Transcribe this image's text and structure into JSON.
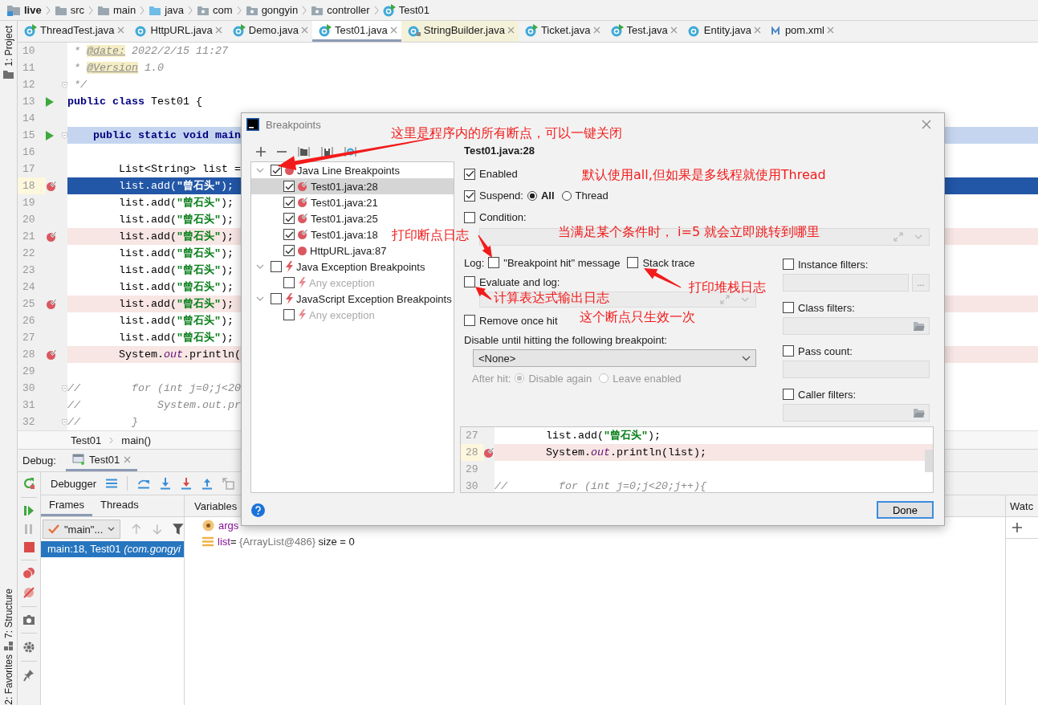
{
  "breadcrumb": [
    {
      "label": "live",
      "kind": "module"
    },
    {
      "label": "src",
      "kind": "folder"
    },
    {
      "label": "main",
      "kind": "folder"
    },
    {
      "label": "java",
      "kind": "source-root"
    },
    {
      "label": "com",
      "kind": "package"
    },
    {
      "label": "gongyin",
      "kind": "package"
    },
    {
      "label": "controller",
      "kind": "package"
    },
    {
      "label": "Test01",
      "kind": "class"
    }
  ],
  "tool_windows": {
    "top": [
      {
        "label": "1: Project",
        "kind": "project"
      }
    ],
    "bottom": [
      {
        "label": "7: Structure",
        "kind": "structure"
      },
      {
        "label": "2: Favorites",
        "kind": "favorites"
      }
    ]
  },
  "tabs": [
    {
      "label": "ThreadTest.java",
      "kind": "runnable",
      "selected": false
    },
    {
      "label": "HttpURL.java",
      "kind": "class",
      "selected": false
    },
    {
      "label": "Demo.java",
      "kind": "runnable",
      "selected": false
    },
    {
      "label": "Test01.java",
      "kind": "runnable",
      "selected": true
    },
    {
      "label": "StringBuilder.java",
      "kind": "library",
      "selected": false
    },
    {
      "label": "Ticket.java",
      "kind": "runnable",
      "selected": false
    },
    {
      "label": "Test.java",
      "kind": "runnable",
      "selected": false
    },
    {
      "label": "Entity.java",
      "kind": "class",
      "selected": false
    },
    {
      "label": "pom.xml",
      "kind": "maven",
      "selected": false
    }
  ],
  "editor": {
    "lines": [
      {
        "number": "10",
        "tokens": [
          {
            "text": " * ",
            "kind": "comment"
          },
          {
            "text": "@date:",
            "kind": "doctag"
          },
          {
            "text": " 2022/2/15 11:27",
            "kind": "comment"
          }
        ]
      },
      {
        "number": "11",
        "tokens": [
          {
            "text": " * ",
            "kind": "comment"
          },
          {
            "text": "@Version",
            "kind": "doctag"
          },
          {
            "text": " 1.0",
            "kind": "comment"
          }
        ]
      },
      {
        "number": "12",
        "fold": true,
        "tokens": [
          {
            "text": " */",
            "kind": "comment"
          }
        ]
      },
      {
        "number": "13",
        "run_marker": true,
        "tokens": [
          {
            "text": "public class",
            "kind": "keyword"
          },
          {
            "text": " Test01 {",
            "kind": "plain"
          }
        ]
      },
      {
        "number": "14"
      },
      {
        "number": "15",
        "run_marker": true,
        "fold": true,
        "highlighted": true,
        "tokens": [
          {
            "text": "    public static void main",
            "kind": "keyword"
          }
        ]
      },
      {
        "number": "16"
      },
      {
        "number": "17",
        "tokens": [
          {
            "text": "        List<String> list =",
            "kind": "plain"
          }
        ]
      },
      {
        "number": "18",
        "breakpoint": true,
        "current": true,
        "execution_point": true,
        "tokens": [
          {
            "text": "        list.add(",
            "kind": "plain"
          },
          {
            "text": "\"曾石头\"",
            "kind": "string"
          },
          {
            "text": ");",
            "kind": "plain"
          }
        ]
      },
      {
        "number": "19",
        "tokens": [
          {
            "text": "        list.add(",
            "kind": "plain"
          },
          {
            "text": "\"曾石头\"",
            "kind": "string"
          },
          {
            "text": ");",
            "kind": "plain"
          }
        ]
      },
      {
        "number": "20",
        "tokens": [
          {
            "text": "        list.add(",
            "kind": "plain"
          },
          {
            "text": "\"曾石头\"",
            "kind": "string"
          },
          {
            "text": ");",
            "kind": "plain"
          }
        ]
      },
      {
        "number": "21",
        "breakpoint": true,
        "tokens": [
          {
            "text": "        list.add(",
            "kind": "plain"
          },
          {
            "text": "\"曾石头\"",
            "kind": "string"
          },
          {
            "text": ");",
            "kind": "plain"
          }
        ]
      },
      {
        "number": "22",
        "tokens": [
          {
            "text": "        list.add(",
            "kind": "plain"
          },
          {
            "text": "\"曾石头\"",
            "kind": "string"
          },
          {
            "text": ");",
            "kind": "plain"
          }
        ]
      },
      {
        "number": "23",
        "tokens": [
          {
            "text": "        list.add(",
            "kind": "plain"
          },
          {
            "text": "\"曾石头\"",
            "kind": "string"
          },
          {
            "text": ");",
            "kind": "plain"
          }
        ]
      },
      {
        "number": "24",
        "tokens": [
          {
            "text": "        list.add(",
            "kind": "plain"
          },
          {
            "text": "\"曾石头\"",
            "kind": "string"
          },
          {
            "text": ");",
            "kind": "plain"
          }
        ]
      },
      {
        "number": "25",
        "breakpoint": true,
        "tokens": [
          {
            "text": "        list.add(",
            "kind": "plain"
          },
          {
            "text": "\"曾石头\"",
            "kind": "string"
          },
          {
            "text": ");",
            "kind": "plain"
          }
        ]
      },
      {
        "number": "26",
        "tokens": [
          {
            "text": "        list.add(",
            "kind": "plain"
          },
          {
            "text": "\"曾石头\"",
            "kind": "string"
          },
          {
            "text": ");",
            "kind": "plain"
          }
        ]
      },
      {
        "number": "27",
        "tokens": [
          {
            "text": "        list.add(",
            "kind": "plain"
          },
          {
            "text": "\"曾石头\"",
            "kind": "string"
          },
          {
            "text": ");",
            "kind": "plain"
          }
        ]
      },
      {
        "number": "28",
        "breakpoint": true,
        "tokens": [
          {
            "text": "        System.",
            "kind": "plain"
          },
          {
            "text": "out",
            "kind": "field"
          },
          {
            "text": ".println(",
            "kind": "plain"
          }
        ]
      },
      {
        "number": "29"
      },
      {
        "number": "30",
        "fold": true,
        "tokens": [
          {
            "text": "//        for (int j=0;j<20",
            "kind": "comment"
          }
        ]
      },
      {
        "number": "31",
        "tokens": [
          {
            "text": "//            System.out.pr",
            "kind": "comment"
          }
        ]
      },
      {
        "number": "32",
        "fold": true,
        "tokens": [
          {
            "text": "//        }",
            "kind": "comment"
          }
        ]
      }
    ],
    "crumbs": [
      "Test01",
      "main()"
    ]
  },
  "debug": {
    "label": "Debug:",
    "tab": "Test01",
    "toolbar_title": "Debugger",
    "frame_tabs": [
      {
        "label": "Frames",
        "selected": true
      },
      {
        "label": "Threads",
        "selected": false
      }
    ],
    "thread": "\"main\"...",
    "frames": [
      {
        "text": "main:18, Test01 *(com.gongyi*",
        "selected": true
      }
    ],
    "variables_title": "Variables",
    "variables": [
      {
        "name": "args",
        "kind": "param"
      },
      {
        "name": "list",
        "kind": "field",
        "separator": "=",
        "value": "{ArrayList@486}",
        "extra": "size = 0"
      }
    ],
    "watches_title": "Watc"
  },
  "dialog": {
    "title": "Breakpoints",
    "tree": [
      {
        "label": "Java Line Breakpoints",
        "kind": "line",
        "checked": true,
        "expanded": true,
        "children": [
          {
            "label": "Test01.java:28",
            "kind": "verified",
            "checked": true,
            "selected": true
          },
          {
            "label": "Test01.java:21",
            "kind": "verified",
            "checked": true,
            "selected": false
          },
          {
            "label": "Test01.java:25",
            "kind": "verified",
            "checked": true,
            "selected": false
          },
          {
            "label": "Test01.java:18",
            "kind": "verified",
            "checked": true,
            "selected": false
          },
          {
            "label": "HttpURL.java:87",
            "kind": "line",
            "checked": true,
            "selected": false
          }
        ]
      },
      {
        "label": "Java Exception Breakpoints",
        "kind": "exception",
        "checked": false,
        "expanded": true,
        "children": [
          {
            "label": "Any exception",
            "kind": "exception",
            "checked": false,
            "disabled": true,
            "selected": false
          }
        ]
      },
      {
        "label": "JavaScript Exception Breakpoints",
        "kind": "exception",
        "checked": false,
        "expanded": true,
        "children": [
          {
            "label": "Any exception",
            "kind": "exception",
            "checked": false,
            "disabled": true,
            "selected": false
          }
        ]
      }
    ],
    "detail": {
      "title": "Test01.java:28",
      "enabled": {
        "label": "Enabled",
        "checked": true
      },
      "suspend": {
        "label": "Suspend:",
        "checked": true,
        "options": [
          {
            "label": "All",
            "selected": true
          },
          {
            "label": "Thread",
            "selected": false
          }
        ]
      },
      "condition": {
        "label": "Condition:",
        "checked": false
      },
      "log": {
        "label": "Log:",
        "options": [
          {
            "label": "\"Breakpoint hit\" message",
            "checked": false
          },
          {
            "label": "Stack trace",
            "checked": false
          }
        ]
      },
      "evaluate": {
        "label": "Evaluate and log:",
        "checked": false
      },
      "remove_once_hit": {
        "label": "Remove once hit",
        "checked": false
      },
      "disable_until": {
        "label": "Disable until hitting the following breakpoint:",
        "value": "<None>"
      },
      "after_hit": {
        "label": "After hit:",
        "disabled": true,
        "options": [
          {
            "label": "Disable again",
            "selected": true
          },
          {
            "label": "Leave enabled",
            "selected": false
          }
        ]
      },
      "filters": [
        {
          "label": "Instance filters:",
          "checked": false,
          "kind": "button",
          "button": "..."
        },
        {
          "label": "Class filters:",
          "checked": false,
          "kind": "browse"
        },
        {
          "label": "Pass count:",
          "checked": false,
          "kind": "plain"
        },
        {
          "label": "Caller filters:",
          "checked": false,
          "kind": "browse"
        }
      ]
    },
    "preview": [
      {
        "number": "27",
        "tokens": [
          {
            "text": "        list.add(",
            "kind": "plain"
          },
          {
            "text": "\"曾石头\"",
            "kind": "string"
          },
          {
            "text": ");",
            "kind": "plain"
          }
        ]
      },
      {
        "number": "28",
        "breakpoint": true,
        "current": true,
        "tokens": [
          {
            "text": "        System.",
            "kind": "plain"
          },
          {
            "text": "out",
            "kind": "field"
          },
          {
            "text": ".println(list);",
            "kind": "plain"
          }
        ]
      },
      {
        "number": "29"
      },
      {
        "number": "30",
        "tokens": [
          {
            "text": "//        for (int j=0;j<20;j++){",
            "kind": "comment"
          }
        ]
      }
    ],
    "done": "Done"
  },
  "annotations": [
    "这里是程序内的所有断点，可以一键关闭",
    "默认使用all,但如果是多线程就使用Thread",
    "打印断点日志",
    "当满足某个条件时， i=5 就会立即跳转到哪里",
    "打印堆栈日志",
    "计算表达式输出日志",
    "这个断点只生效一次"
  ]
}
